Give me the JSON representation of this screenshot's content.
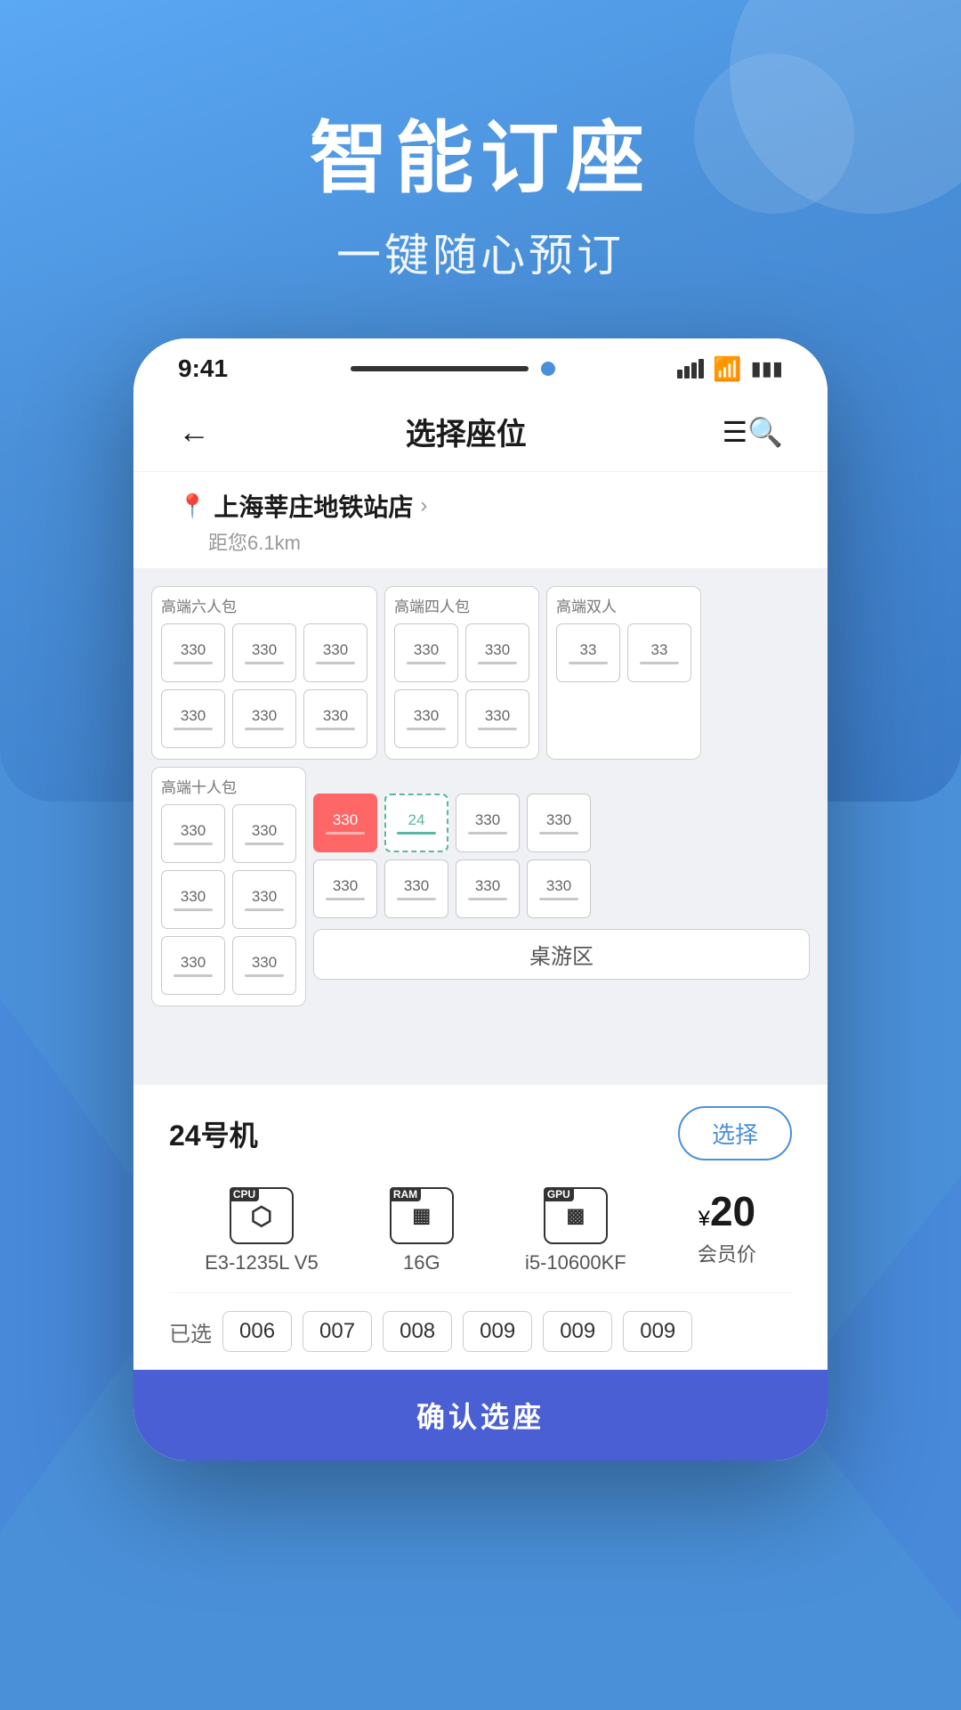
{
  "background": {
    "gradient_start": "#5BA8F5",
    "gradient_end": "#3B7BC8"
  },
  "hero": {
    "title": "智能订座",
    "subtitle": "一键随心预订"
  },
  "status_bar": {
    "time": "9:41"
  },
  "nav": {
    "back_label": "←",
    "title": "选择座位",
    "filter_icon": "≡Q"
  },
  "location": {
    "name": "上海莘庄地铁站店",
    "distance": "距您6.1km"
  },
  "sections": {
    "section1_label": "高端六人包",
    "section2_label": "高端四人包",
    "section3_label": "高端双人",
    "section4_label": "高端十人包",
    "board_game_label": "桌游区",
    "seat_price": "330",
    "selected_seat_number": "24"
  },
  "machine_info": {
    "name": "24号机",
    "select_btn": "选择",
    "cpu_label": "E3-1235L V5",
    "ram_label": "16G",
    "gpu_label": "i5-10600KF",
    "price": "¥20",
    "price_unit": "¥",
    "price_number": "20",
    "price_desc": "会员价",
    "cpu_tag": "CPU",
    "ram_tag": "RAM",
    "gpu_tag": "GPU"
  },
  "selected_seats": {
    "label": "已选",
    "seats": [
      "006",
      "007",
      "008",
      "009",
      "009",
      "009"
    ]
  },
  "confirm_btn": "确认选座"
}
